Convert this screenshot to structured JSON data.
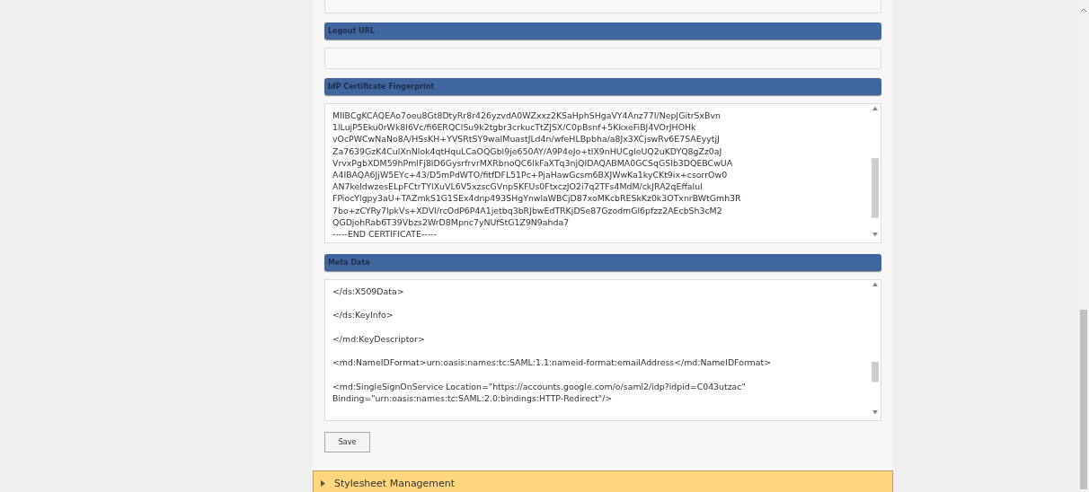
{
  "sections": [
    {
      "kind": "input"
    },
    {
      "kind": "header",
      "label": "Logout URL"
    },
    {
      "kind": "input"
    },
    {
      "kind": "header",
      "label": "IdP Certificate Fingerprint"
    },
    {
      "kind": "certificate",
      "value": "MIIBCgKCAQEAo7oeu8Gt8DtyRr8r426yzvdA0WZxxz2KSaHphSHgaVY4Anz77I/NepJGitrSxBvn\n1lLujP5Eku0rWk8l6Vc/fi6ERQClSu9k2tgbr3crkucTtZJSX/C0pBsnf+5KkxeFiBJ4VOrJHOHk\nvOcPWCwNaNo8A/HSsKH+YVSRtSY9waIMuastJLd4n/wfeHLBpbha/a8Jx3XCjswRv6E7SAEyytjJ\nZa7639GzK4CulXnNlok4qtHquLCaOQGbl9je650AY/A9P4eJo+tlX9nHUCgleUQ2uKDYQ8gZz0aJ\nVrvxPgbXDM59hPmlFj8lD6GysrfrvrMXRbnoQC6lkFaXTq3njQIDAQABMA0GCSqGSIb3DQEBCwUA\nA4IBAQA6JjW5EYc+43/D5mPdWTO/fitfDFL51Pc+PjaHawGcsm6BXJWwKa1kyCKt9ix+csorrOw0\nAN7keldwzesELpFCtrTYlXuVL6V5xzscGVnpSKFUs0FtxczJO2i7q2TFs4MdM/ckJRA2qEffalul\nFPiocYlgpy3aU+TAZmkS1G1SEx4dnp493SHgYnwlaWBCjD87xoMKcbRESkKz0k3OTxnrBWtGmh3R\n7bo+zCYRy7lpkVs+XDVI/rcOdP6P4A1jetbq3bRJbwEdTRKjDSe87GzodmGl6pfzz2AEcbSh3cM2\nQGDjohRab6T39Vbzs2WrD8Mpnc7yNUfStG1Z9N9ahda7\n-----END CERTIFICATE-----"
    },
    {
      "kind": "header",
      "label": "Meta Data"
    },
    {
      "kind": "metadata",
      "value": "</ds:X509Data>\n\n</ds:KeyInfo>\n\n</md:KeyDescriptor>\n\n<md:NameIDFormat>urn:oasis:names:tc:SAML:1.1:nameid-format:emailAddress</md:NameIDFormat>\n\n<md:SingleSignOnService Location=\"https://accounts.google.com/o/saml2/idp?idpid=C043utzac\"\nBinding=\"urn:oasis:names:tc:SAML:2.0:bindings:HTTP-Redirect\"/>"
    },
    {
      "kind": "button",
      "label": "Save"
    }
  ],
  "collapsed_section": {
    "label": "Stylesheet Management",
    "expanded": false
  }
}
